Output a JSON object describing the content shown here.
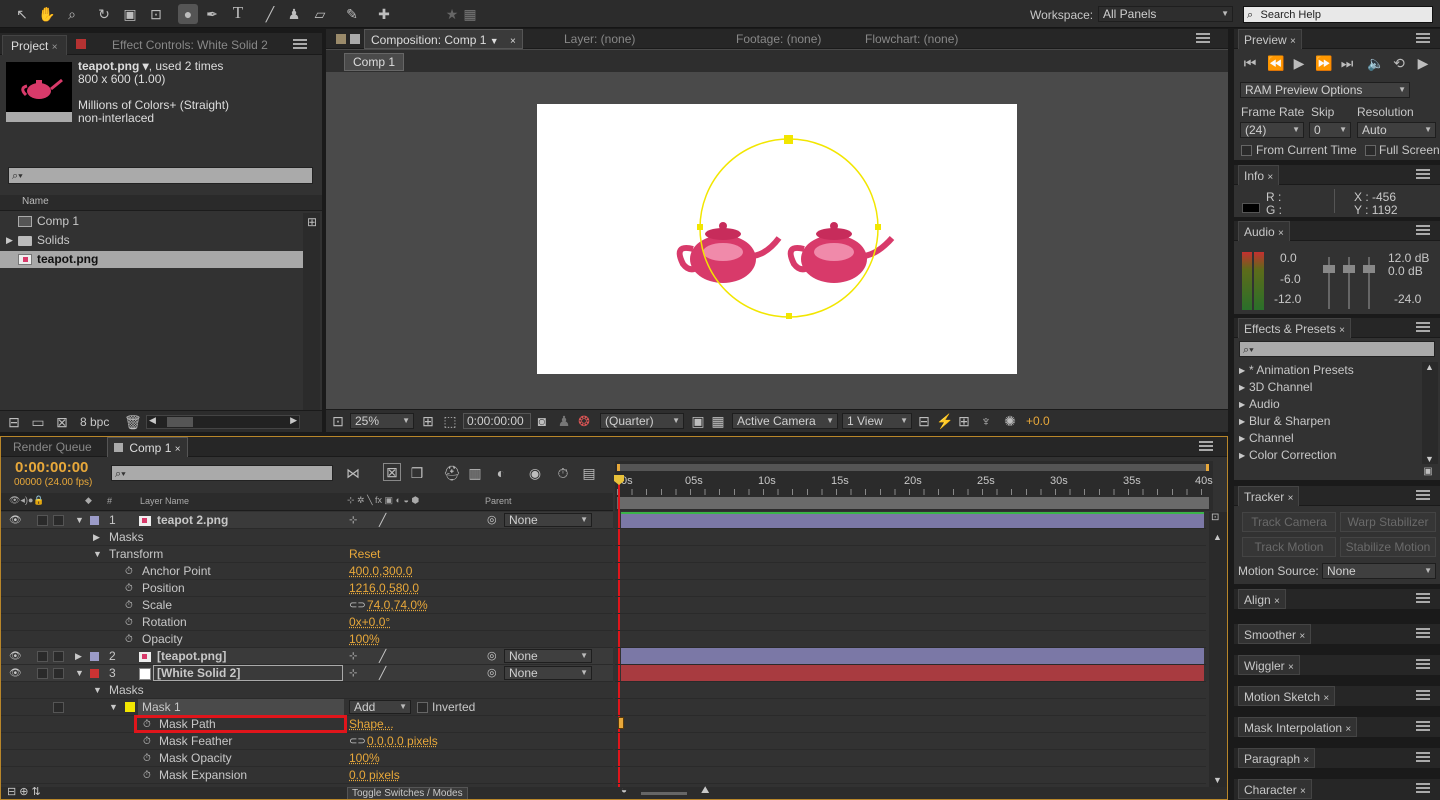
{
  "toolbar": {
    "workspace_label": "Workspace:",
    "workspace_value": "All Panels",
    "search_placeholder": "Search Help"
  },
  "project": {
    "tab_project": "Project",
    "tab_effect": "Effect Controls: White Solid 2",
    "file_name": "teapot.png ▾",
    "usage": ", used 2 times",
    "dims": "800 x 600 (1.00)",
    "colors": "Millions of Colors+ (Straight)",
    "interlace": "non-interlaced",
    "col_name": "Name",
    "items": [
      {
        "name": "Comp 1"
      },
      {
        "name": "Solids"
      },
      {
        "name": "teapot.png"
      }
    ],
    "bpc": "8 bpc"
  },
  "composition": {
    "tab_comp": "Composition: Comp 1",
    "tab_layer": "Layer: (none)",
    "tab_footage": "Footage: (none)",
    "tab_flowchart": "Flowchart: (none)",
    "breadcrumb": "Comp 1",
    "zoom": "25%",
    "timecode": "0:00:00:00",
    "resolution": "(Quarter)",
    "camera": "Active Camera",
    "view": "1 View",
    "exposure": "+0.0"
  },
  "preview": {
    "tab": "Preview",
    "ram_options": "RAM Preview Options",
    "frame_rate_label": "Frame Rate",
    "skip_label": "Skip",
    "resolution_label": "Resolution",
    "frame_rate": "(24)",
    "skip": "0",
    "resolution": "Auto",
    "from_current": "From Current Time",
    "full_screen": "Full Screen"
  },
  "info": {
    "tab": "Info",
    "r": "R :",
    "g": "G :",
    "x": "X : -456",
    "y": "Y : 1192"
  },
  "audio": {
    "tab": "Audio",
    "left_levels": [
      "0.0",
      "-6.0",
      "-12.0"
    ],
    "right_levels": [
      "12.0 dB",
      "0.0 dB",
      "-24.0"
    ]
  },
  "effects": {
    "tab": "Effects & Presets",
    "items": [
      "* Animation Presets",
      "3D Channel",
      "Audio",
      "Blur & Sharpen",
      "Channel",
      "Color Correction"
    ]
  },
  "tracker": {
    "tab": "Tracker",
    "track_camera": "Track Camera",
    "warp_stabilizer": "Warp Stabilizer",
    "track_motion": "Track Motion",
    "stabilize_motion": "Stabilize Motion",
    "motion_source_label": "Motion Source:",
    "motion_source": "None"
  },
  "side_tabs": [
    "Align",
    "Smoother",
    "Wiggler",
    "Motion Sketch",
    "Mask Interpolation",
    "Paragraph",
    "Character"
  ],
  "timeline": {
    "tab_render": "Render Queue",
    "tab_comp": "Comp 1",
    "timecode": "0:00:00:00",
    "frames": "00000 (24.00 fps)",
    "col_layer_name": "Layer Name",
    "col_parent": "Parent",
    "col_num": "#",
    "ruler": [
      "0s",
      "05s",
      "10s",
      "15s",
      "20s",
      "25s",
      "30s",
      "35s",
      "40s"
    ],
    "toggle_label": "Toggle Switches / Modes",
    "rows": [
      {
        "num": "1",
        "name": "teapot 2.png",
        "parent": "None"
      },
      {
        "name": "Masks"
      },
      {
        "name": "Transform",
        "value": "Reset"
      },
      {
        "name": "Anchor Point",
        "value": "400.0,300.0"
      },
      {
        "name": "Position",
        "value": "1216.0,580.0"
      },
      {
        "name": "Scale",
        "value": "74.0,74.0%"
      },
      {
        "name": "Rotation",
        "value": "0x+0.0°"
      },
      {
        "name": "Opacity",
        "value": "100%"
      },
      {
        "num": "2",
        "name": "[teapot.png]",
        "parent": "None"
      },
      {
        "num": "3",
        "name": "[White Solid 2]",
        "parent": "None"
      },
      {
        "name": "Masks"
      },
      {
        "name": "Mask 1",
        "mode": "Add",
        "inverted": "Inverted"
      },
      {
        "name": "Mask Path",
        "value": "Shape..."
      },
      {
        "name": "Mask Feather",
        "value": "0.0,0.0 pixels"
      },
      {
        "name": "Mask Opacity",
        "value": "100%"
      },
      {
        "name": "Mask Expansion",
        "value": "0.0 pixels"
      }
    ]
  },
  "colors": {
    "accent": "#e8a83a",
    "mask_yellow": "#f2e600",
    "highlight_red": "#e0151b",
    "layer_bar_purple": "#7b78a6",
    "layer_bar_red": "#a83b40",
    "teapot_pink": "#d83a6a"
  }
}
